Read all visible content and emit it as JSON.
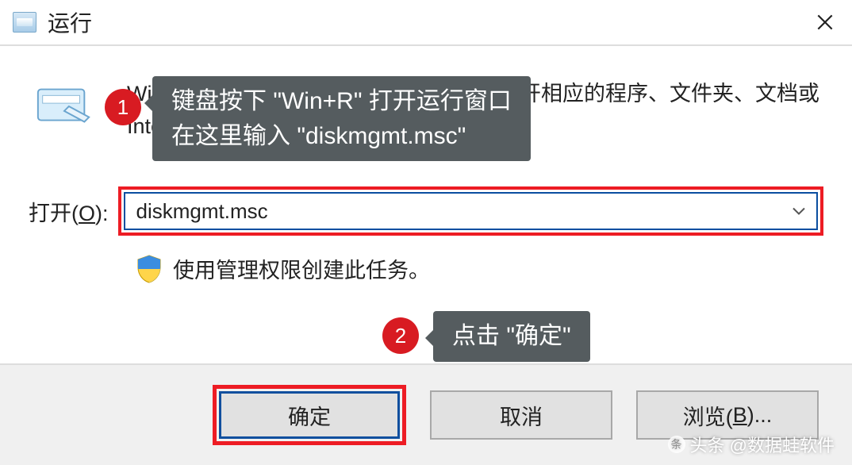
{
  "titlebar": {
    "icon": "run-title-icon",
    "title": "运行"
  },
  "description": "Windows 将根据你所输入的名称，为你打开相应的程序、文件夹、文档或 Internet 资源。",
  "input": {
    "label_prefix": "打开(",
    "label_hotkey": "O",
    "label_suffix": "):",
    "value": "diskmgmt.msc"
  },
  "admin_note": "使用管理权限创建此任务。",
  "buttons": {
    "ok": "确定",
    "cancel": "取消",
    "browse_prefix": "浏览(",
    "browse_hotkey": "B",
    "browse_suffix": ")..."
  },
  "annotations": {
    "badge1": "1",
    "callout1_line1": "键盘按下 \"Win+R\" 打开运行窗口",
    "callout1_line2": "在这里输入 \"diskmgmt.msc\"",
    "badge2": "2",
    "callout2": "点击 \"确定\""
  },
  "watermark": "头条 @数据蛙软件"
}
